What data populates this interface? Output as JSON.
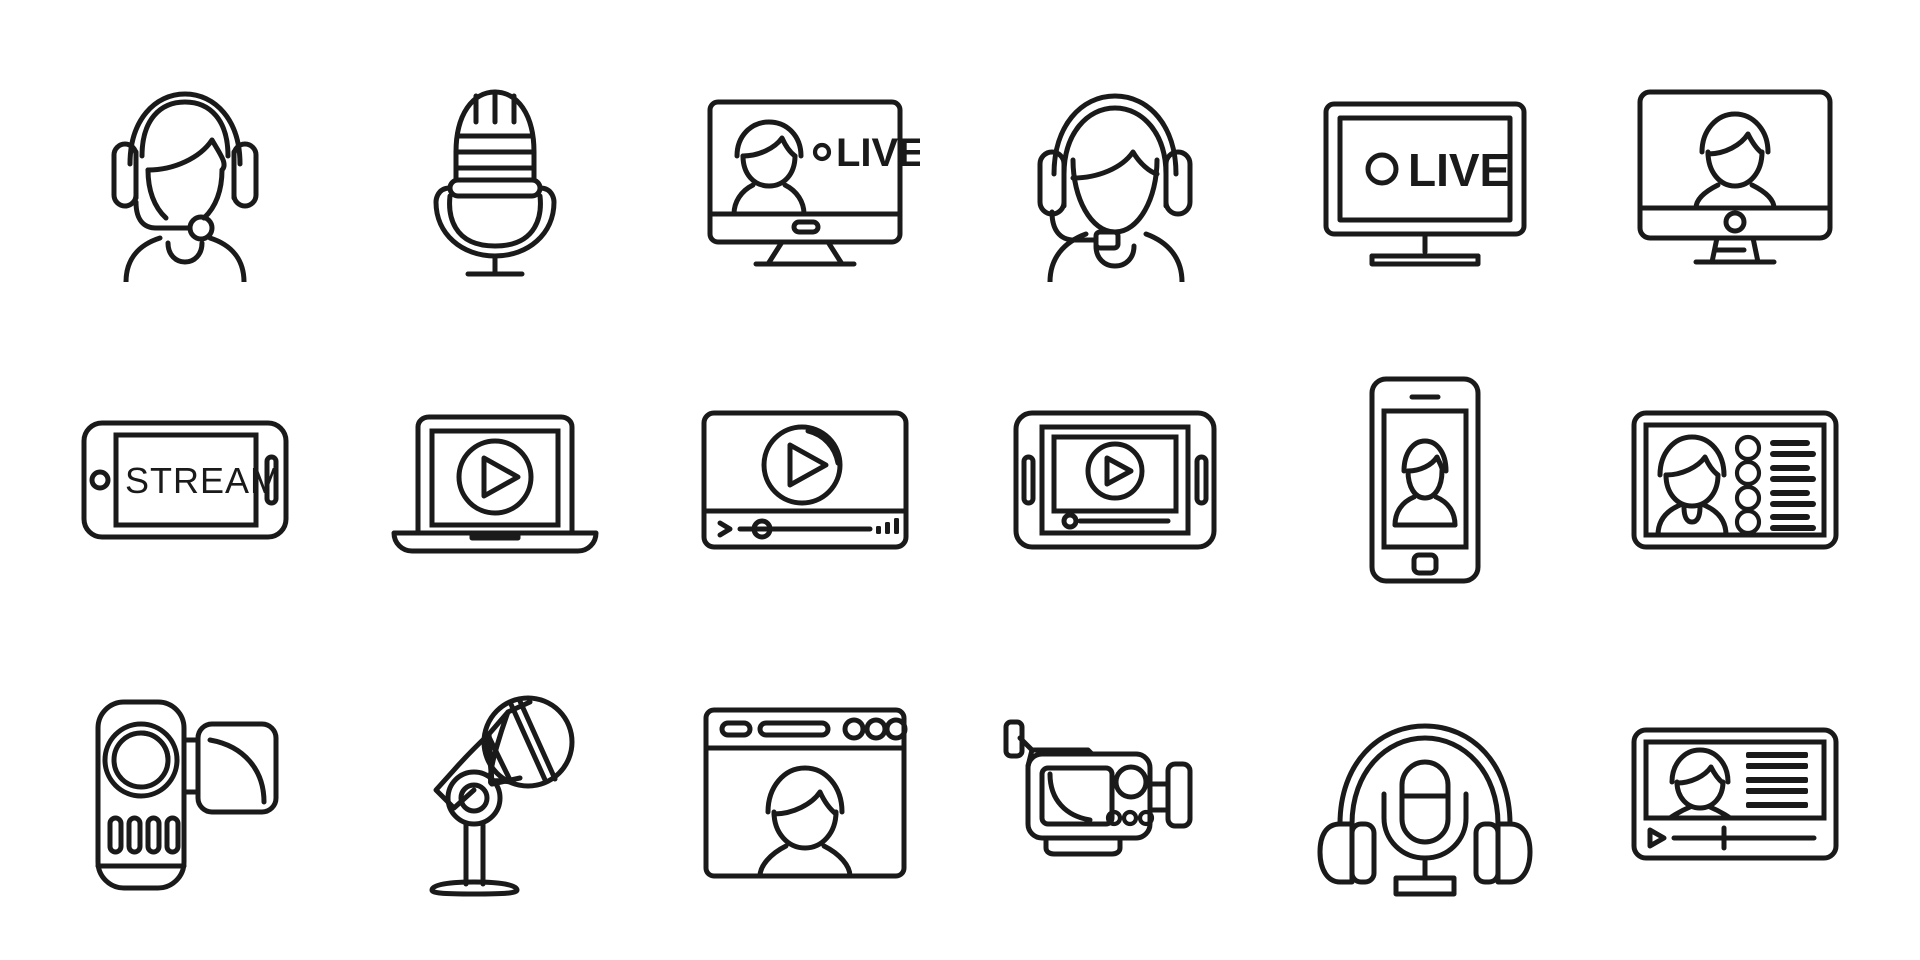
{
  "sheet": {
    "title": "Live streaming icons set, outline style",
    "columns": 6,
    "rows": 3,
    "stroke_color": "#1a1a1a",
    "background_color": "#ffffff",
    "stroke_width": 5
  },
  "labels": {
    "live_screen": "LIVE",
    "live_tv": "LIVE",
    "stream_tablet": "STREAM"
  },
  "icons": [
    {
      "index": 1,
      "row": 1,
      "col": 1,
      "name": "operator-woman-headset",
      "label": "Support operator with headset"
    },
    {
      "index": 2,
      "row": 1,
      "col": 2,
      "name": "retro-microphone",
      "label": "Retro studio microphone"
    },
    {
      "index": 3,
      "row": 1,
      "col": 3,
      "name": "monitor-live-broadcast",
      "label": "Desktop monitor live broadcast"
    },
    {
      "index": 4,
      "row": 1,
      "col": 4,
      "name": "operator-man-headset",
      "label": "Man wearing headset with mic"
    },
    {
      "index": 5,
      "row": 1,
      "col": 5,
      "name": "tv-live",
      "label": "Television showing LIVE"
    },
    {
      "index": 6,
      "row": 1,
      "col": 6,
      "name": "monitor-video-call",
      "label": "Monitor with video call person"
    },
    {
      "index": 7,
      "row": 2,
      "col": 1,
      "name": "tablet-stream",
      "label": "Tablet showing STREAM"
    },
    {
      "index": 8,
      "row": 2,
      "col": 2,
      "name": "laptop-play",
      "label": "Laptop with play button"
    },
    {
      "index": 9,
      "row": 2,
      "col": 3,
      "name": "video-player-timeline",
      "label": "Video player with timeline"
    },
    {
      "index": 10,
      "row": 2,
      "col": 4,
      "name": "tablet-video-player",
      "label": "Tablet video player"
    },
    {
      "index": 11,
      "row": 2,
      "col": 5,
      "name": "smartphone-video-call",
      "label": "Smartphone video call"
    },
    {
      "index": 12,
      "row": 2,
      "col": 6,
      "name": "webinar-participants",
      "label": "Webinar screen with participant list"
    },
    {
      "index": 13,
      "row": 3,
      "col": 1,
      "name": "camcorder",
      "label": "Handheld camcorder"
    },
    {
      "index": 14,
      "row": 3,
      "col": 2,
      "name": "studio-microphone-stand",
      "label": "Microphone on stand"
    },
    {
      "index": 15,
      "row": 3,
      "col": 3,
      "name": "browser-window-person",
      "label": "Browser window with person"
    },
    {
      "index": 16,
      "row": 3,
      "col": 4,
      "name": "professional-video-camera",
      "label": "Professional video camera"
    },
    {
      "index": 17,
      "row": 3,
      "col": 5,
      "name": "podcast-headphones-mic",
      "label": "Headphones with microphone"
    },
    {
      "index": 18,
      "row": 3,
      "col": 6,
      "name": "video-lecture-player",
      "label": "Video lecture player with text"
    }
  ]
}
